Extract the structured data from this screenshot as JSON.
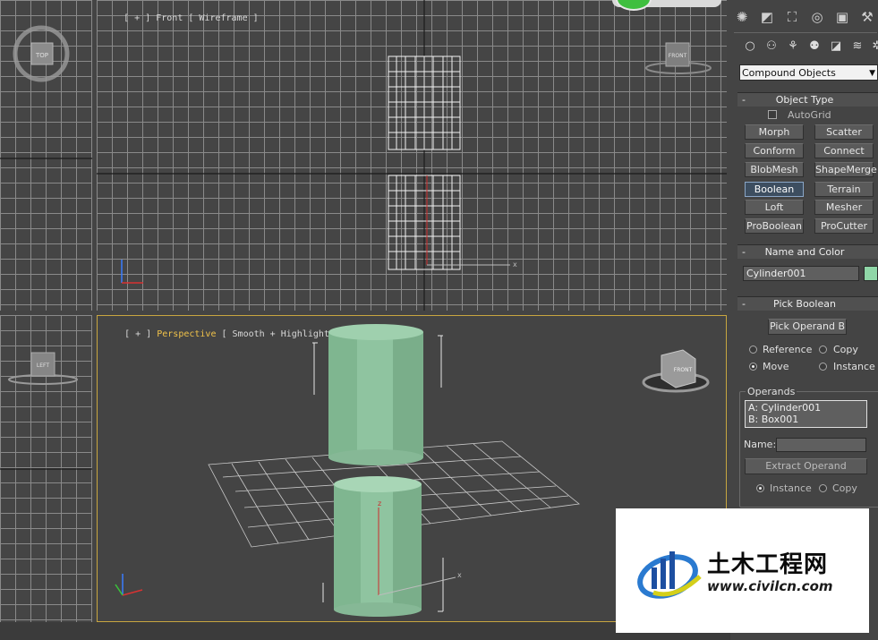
{
  "viewports": {
    "front": {
      "label_prefix": "[ + ]",
      "name": "Front",
      "mode": "[ Wireframe ]"
    },
    "perspective": {
      "label_prefix": "[ + ]",
      "name": "Perspective",
      "mode": "[ Smooth + Highlights ]"
    },
    "gizmo_top": "TOP",
    "gizmo_front": "FRONT",
    "gizmo_left": "LEFT",
    "gizmo_persp": "FRONT"
  },
  "command_panel": {
    "category_dropdown": "Compound Objects",
    "object_type": {
      "title": "Object Type",
      "autogrid_label": "AutoGrid",
      "buttons": [
        "Morph",
        "Scatter",
        "Conform",
        "Connect",
        "BlobMesh",
        "ShapeMerge",
        "Boolean",
        "Terrain",
        "Loft",
        "Mesher",
        "ProBoolean",
        "ProCutter"
      ]
    },
    "name_and_color": {
      "title": "Name and Color",
      "object_name": "Cylinder001",
      "color": "#8fd6a7"
    },
    "pick_boolean": {
      "title": "Pick Boolean",
      "pick_button": "Pick Operand B",
      "options": [
        "Reference",
        "Copy",
        "Move",
        "Instance"
      ],
      "selected": "Move"
    },
    "operands": {
      "title": "Operands",
      "list": [
        "A: Cylinder001",
        "B: Box001"
      ],
      "name_label": "Name:",
      "name_value": "",
      "extract_button": "Extract Operand",
      "extract_options": [
        "Instance",
        "Copy"
      ],
      "extract_selected": "Instance"
    }
  },
  "watermark": {
    "title": "土木工程网",
    "url": "www.civilcn.com"
  },
  "colors": {
    "viewport_border_active": "#c8a640",
    "cylinder": "#8fc4a0",
    "panel_bg": "#444444"
  }
}
